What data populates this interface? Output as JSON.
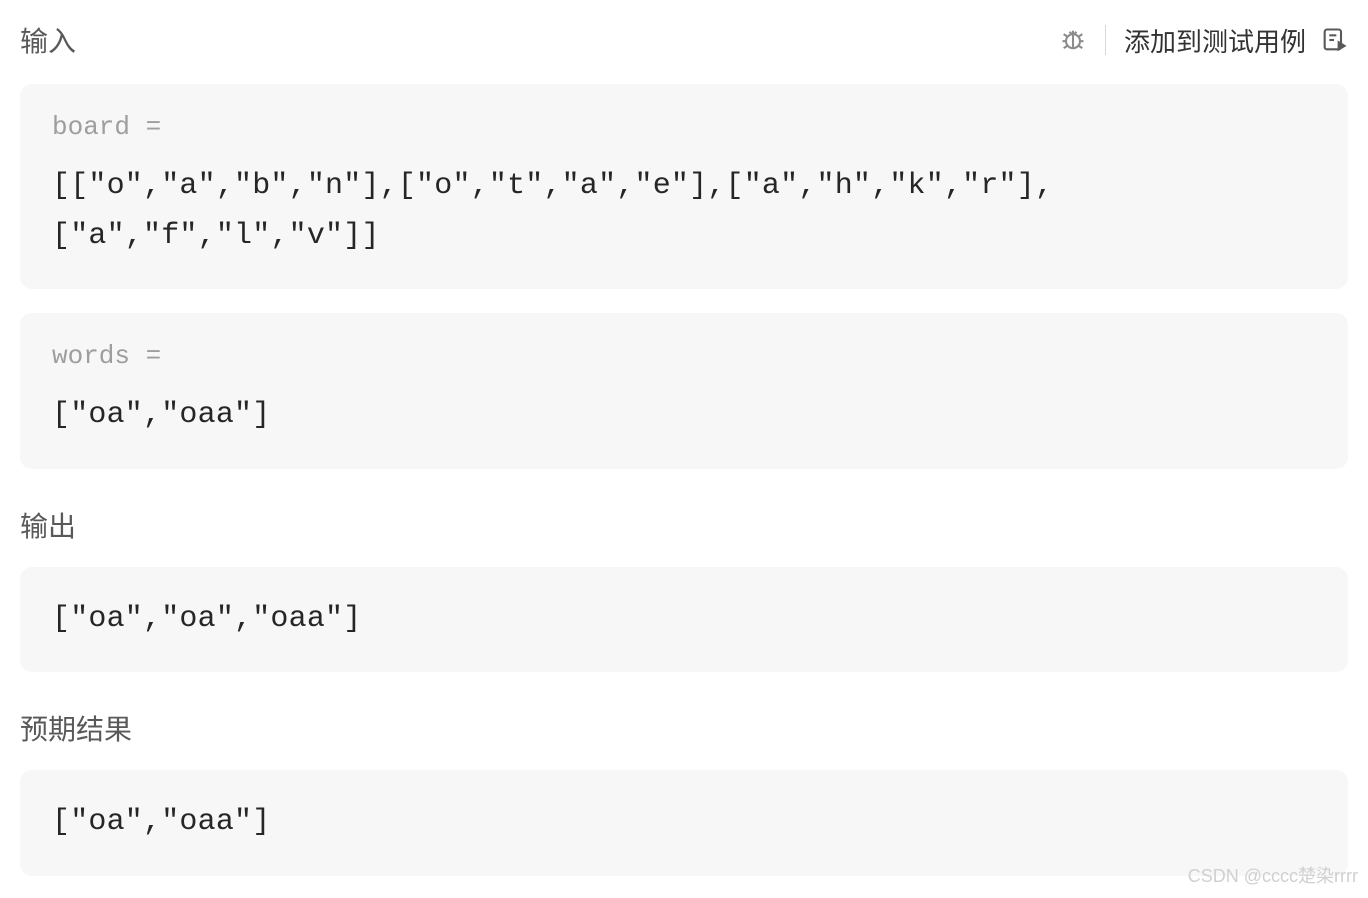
{
  "header": {
    "input_label": "输入",
    "add_testcase_label": "添加到测试用例"
  },
  "input_blocks": [
    {
      "label": "board =",
      "value": "[[\"o\",\"a\",\"b\",\"n\"],[\"o\",\"t\",\"a\",\"e\"],[\"a\",\"h\",\"k\",\"r\"],[\"a\",\"f\",\"l\",\"v\"]]"
    },
    {
      "label": "words =",
      "value": "[\"oa\",\"oaa\"]"
    }
  ],
  "output": {
    "label": "输出",
    "value": "[\"oa\",\"oa\",\"oaa\"]"
  },
  "expected": {
    "label": "预期结果",
    "value": "[\"oa\",\"oaa\"]"
  },
  "watermark": "CSDN @cccc楚染rrrr"
}
